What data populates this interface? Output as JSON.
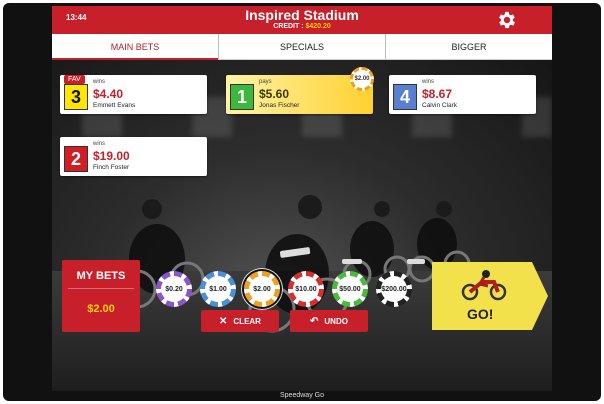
{
  "header": {
    "time": "13:44",
    "title": "Inspired Stadium",
    "credit_label": "CREDIT : ",
    "credit_value": "$420.20",
    "settings_icon": "gear-icon"
  },
  "tabs": [
    {
      "label": "MAIN BETS",
      "active": true
    },
    {
      "label": "SPECIALS",
      "active": false
    },
    {
      "label": "BIGGER",
      "active": false
    }
  ],
  "bets": [
    {
      "number": "3",
      "label": "wins",
      "odds": "$4.40",
      "rider": "Emmett Evans",
      "badge": "FAV",
      "box_color": "#ffe600",
      "text_color": "#111111",
      "selected": false
    },
    {
      "number": "1",
      "label": "pays",
      "odds": "$5.60",
      "rider": "Jonas Fischer",
      "stake": "$2.00",
      "box_color": "#3cb93c",
      "text_color": "#ffffff",
      "selected": true
    },
    {
      "number": "4",
      "label": "wins",
      "odds": "$8.67",
      "rider": "Calvin Clark",
      "box_color": "#5a7fd0",
      "text_color": "#ffffff",
      "selected": false
    },
    {
      "number": "2",
      "label": "wins",
      "odds": "$19.00",
      "rider": "Finch Foster",
      "box_color": "#d01e24",
      "text_color": "#ffffff",
      "selected": false
    }
  ],
  "my_bets": {
    "title": "MY BETS",
    "value": "$2.00"
  },
  "chips": [
    {
      "value": "$0.20",
      "color": "#8a56c8",
      "selected": false
    },
    {
      "value": "$1.00",
      "color": "#4a90d9",
      "selected": false
    },
    {
      "value": "$2.00",
      "color": "#f0a020",
      "selected": true
    },
    {
      "value": "$10.00",
      "color": "#d43030",
      "selected": false
    },
    {
      "value": "$50.00",
      "color": "#4cba3c",
      "selected": false
    },
    {
      "value": "$200.00",
      "color": "#222222",
      "selected": false
    }
  ],
  "actions": {
    "clear_label": "CLEAR",
    "undo_label": "UNDO"
  },
  "go": {
    "label": "GO!",
    "color": "#f2e14a"
  },
  "footer": "Speedway Go"
}
